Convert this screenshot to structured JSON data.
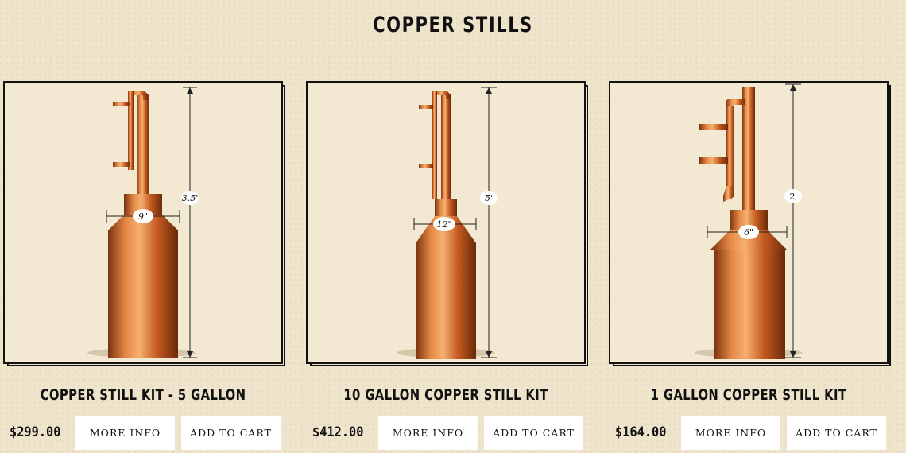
{
  "page": {
    "title": "COPPER STILLS"
  },
  "products": [
    {
      "name": "COPPER STILL KIT - 5 GALLON",
      "price": "$299.00",
      "more_info_label": "MORE INFO",
      "add_to_cart_label": "ADD TO CART",
      "height_label": "3.5'",
      "diameter_label": "9\""
    },
    {
      "name": "10 GALLON COPPER STILL KIT",
      "price": "$412.00",
      "more_info_label": "MORE INFO",
      "add_to_cart_label": "ADD TO CART",
      "height_label": "5'",
      "diameter_label": "12\""
    },
    {
      "name": "1 GALLON COPPER STILL KIT",
      "price": "$164.00",
      "more_info_label": "MORE INFO",
      "add_to_cart_label": "ADD TO CART",
      "height_label": "2'",
      "diameter_label": "6\""
    }
  ],
  "colors": {
    "background": "#efe4cc",
    "copper_light": "#f0a060",
    "copper": "#d2692a",
    "copper_dark": "#8a3a10"
  }
}
